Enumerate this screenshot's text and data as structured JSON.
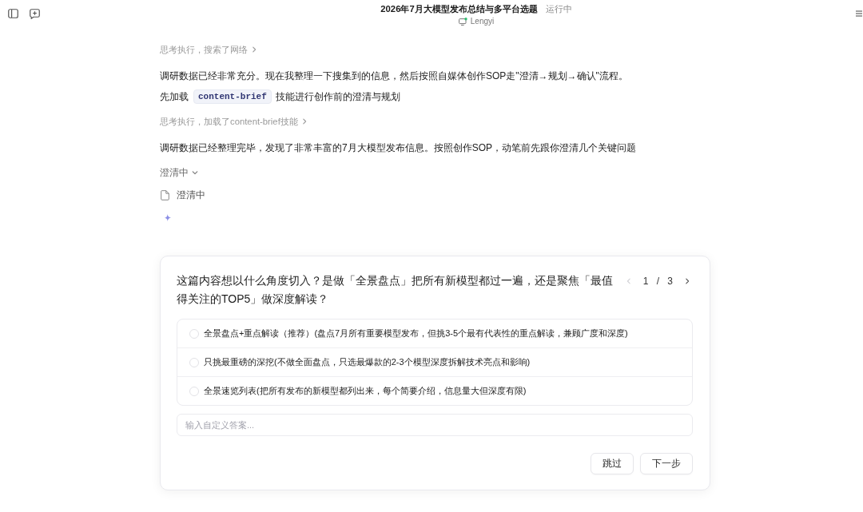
{
  "header": {
    "title": "2026年7月大模型发布总结与多平台选题",
    "status": "运行中",
    "agent": "Lengyi"
  },
  "messages": [
    {
      "kind": "step",
      "text": "思考执行，搜索了网络",
      "expanded": false
    },
    {
      "kind": "text",
      "text": "调研数据已经非常充分。现在我整理一下搜集到的信息，然后按照自媒体创作SOP走\"澄清→规划→确认\"流程。"
    },
    {
      "kind": "text_code",
      "before": "先加载",
      "code": "content-brief",
      "after": "技能进行创作前的澄清与规划"
    },
    {
      "kind": "step",
      "text": "思考执行，加载了content-brief技能",
      "expanded": false
    },
    {
      "kind": "text",
      "text": "调研数据已经整理完毕，发现了非常丰富的7月大模型发布信息。按照创作SOP，动笔前先跟你澄清几个关键问题"
    },
    {
      "kind": "group",
      "text": "澄清中",
      "expanded": true
    },
    {
      "kind": "file",
      "text": "澄清中"
    },
    {
      "kind": "loading"
    }
  ],
  "question_card": {
    "question": "这篇内容想以什么角度切入？是做「全景盘点」把所有新模型都过一遍，还是聚焦「最值得关注的TOP5」做深度解读？",
    "pager": {
      "text": "1 / 3",
      "prev_disabled": true,
      "next_disabled": false
    },
    "options": [
      {
        "label": "全景盘点+重点解读（推荐）(盘点7月所有重要模型发布，但挑3-5个最有代表性的重点解读，兼顾广度和深度)",
        "selected": false
      },
      {
        "label": "只挑最重磅的深挖(不做全面盘点，只选最爆款的2-3个模型深度拆解技术亮点和影响)",
        "selected": false
      },
      {
        "label": "全景速览列表(把所有发布的新模型都列出来，每个简要介绍，信息量大但深度有限)",
        "selected": false
      }
    ],
    "custom_answer": {
      "placeholder": "输入自定义答案..."
    },
    "buttons": [
      "跳过",
      "下一步"
    ]
  }
}
